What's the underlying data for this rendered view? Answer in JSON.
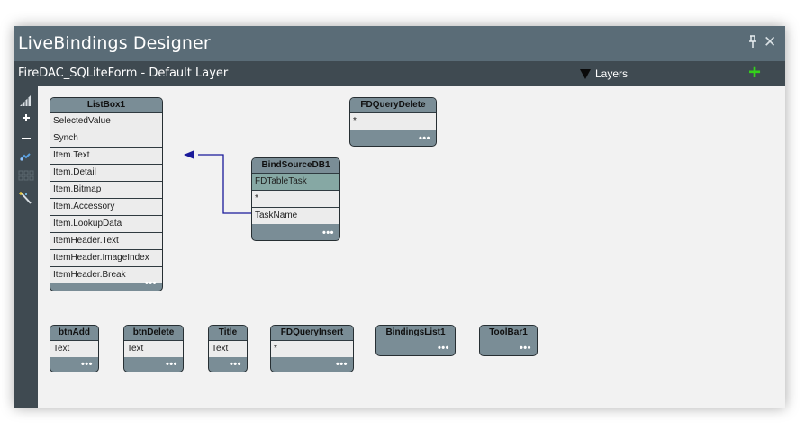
{
  "window": {
    "title": "LiveBindings Designer",
    "pin_glyph": "ꟸ",
    "close_glyph": "✕"
  },
  "subbar": {
    "form_label": "FireDAC_SQLiteForm  - Default Layer",
    "layers_label": "Layers",
    "add_glyph": "+"
  },
  "toolbar": {
    "items": [
      "grid-toggle-icon",
      "zoom-in-icon",
      "zoom-out-icon",
      "link-icon",
      "arrange-grid-icon",
      "magic-wand-icon"
    ]
  },
  "nodes": {
    "listbox1": {
      "title": "ListBox1",
      "fields": [
        "SelectedValue",
        "Synch",
        "Item.Text",
        "Item.Detail",
        "Item.Bitmap",
        "Item.Accessory",
        "Item.LookupData",
        "ItemHeader.Text",
        "ItemHeader.ImageIndex",
        "ItemHeader.Break"
      ]
    },
    "fdquerydelete": {
      "title": "FDQueryDelete",
      "fields": [
        "*"
      ]
    },
    "bindsourcedb1": {
      "title": "BindSourceDB1",
      "fields": [
        "FDTableTask",
        "*",
        "TaskName"
      ]
    },
    "btnadd": {
      "title": "btnAdd",
      "fields": [
        "Text"
      ]
    },
    "btndelete": {
      "title": "btnDelete",
      "fields": [
        "Text"
      ]
    },
    "title": {
      "title": "Title",
      "fields": [
        "Text"
      ]
    },
    "fdqueryinsert": {
      "title": "FDQueryInsert",
      "fields": [
        "*"
      ]
    },
    "bindingslist1": {
      "title": "BindingsList1",
      "fields": []
    },
    "toolbar1": {
      "title": "ToolBar1",
      "fields": []
    }
  },
  "more_glyph": "•••",
  "colors": {
    "title_bar": "#5a6c77",
    "sub_bar": "#3f4a51",
    "node_header": "#7a8d96",
    "field_bg": "#ececec",
    "selected_field": "#86a8a4",
    "link_line": "#1a1a9a",
    "add_button": "#34d11a"
  }
}
